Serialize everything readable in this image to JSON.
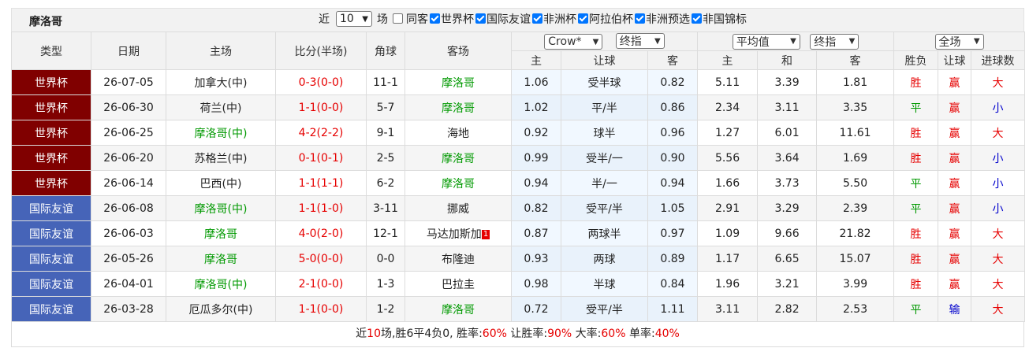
{
  "team": "摩洛哥",
  "filters": {
    "recent_prefix": "近",
    "recent_value": "10",
    "recent_suffix": "场",
    "same_home": "同客",
    "comps": [
      "世界杯",
      "国际友谊",
      "非洲杯",
      "阿拉伯杯",
      "非洲预选",
      "非国锦标"
    ]
  },
  "header": {
    "type": "类型",
    "date": "日期",
    "home": "主场",
    "score": "比分(半场)",
    "corner": "角球",
    "away": "客场",
    "company": "Crow*",
    "odds_kind1": "终指",
    "avg": "平均值",
    "odds_kind2": "终指",
    "range": "全场",
    "sub": {
      "h1": "主",
      "handicap": "让球",
      "a1": "客",
      "h2": "主",
      "draw": "和",
      "a2": "客",
      "wdl": "胜负",
      "hcp": "让球",
      "goals": "进球数"
    }
  },
  "rows": [
    {
      "type": "世界杯",
      "date": "26-07-05",
      "home": "加拿大(中)",
      "score": "0-3",
      "half": "(0-0)",
      "corner": "11-1",
      "away": "摩洛哥",
      "badge": "",
      "o1": "1.06",
      "hcp": "受半球",
      "o2": "0.82",
      "e1": "5.11",
      "e2": "3.39",
      "e3": "1.81",
      "wdl": "胜",
      "hr": "赢",
      "goals": "大"
    },
    {
      "type": "世界杯",
      "date": "26-06-30",
      "home": "荷兰(中)",
      "score": "1-1",
      "half": "(0-0)",
      "corner": "5-7",
      "away": "摩洛哥",
      "badge": "",
      "o1": "1.02",
      "hcp": "平/半",
      "o2": "0.86",
      "e1": "2.34",
      "e2": "3.11",
      "e3": "3.35",
      "wdl": "平",
      "hr": "赢",
      "goals": "小"
    },
    {
      "type": "世界杯",
      "date": "26-06-25",
      "home": "摩洛哥(中)",
      "score": "4-2",
      "half": "(2-2)",
      "corner": "9-1",
      "away": "海地",
      "badge": "",
      "o1": "0.92",
      "hcp": "球半",
      "o2": "0.96",
      "e1": "1.27",
      "e2": "6.01",
      "e3": "11.61",
      "wdl": "胜",
      "hr": "赢",
      "goals": "大"
    },
    {
      "type": "世界杯",
      "date": "26-06-20",
      "home": "苏格兰(中)",
      "score": "0-1",
      "half": "(0-1)",
      "corner": "2-5",
      "away": "摩洛哥",
      "badge": "",
      "o1": "0.99",
      "hcp": "受半/一",
      "o2": "0.90",
      "e1": "5.56",
      "e2": "3.64",
      "e3": "1.69",
      "wdl": "胜",
      "hr": "赢",
      "goals": "小"
    },
    {
      "type": "世界杯",
      "date": "26-06-14",
      "home": "巴西(中)",
      "score": "1-1",
      "half": "(1-1)",
      "corner": "6-2",
      "away": "摩洛哥",
      "badge": "",
      "o1": "0.94",
      "hcp": "半/一",
      "o2": "0.94",
      "e1": "1.66",
      "e2": "3.73",
      "e3": "5.50",
      "wdl": "平",
      "hr": "赢",
      "goals": "小"
    },
    {
      "type": "国际友谊",
      "date": "26-06-08",
      "home": "摩洛哥(中)",
      "score": "1-1",
      "half": "(1-0)",
      "corner": "3-11",
      "away": "挪威",
      "badge": "",
      "o1": "0.82",
      "hcp": "受平/半",
      "o2": "1.05",
      "e1": "2.91",
      "e2": "3.29",
      "e3": "2.39",
      "wdl": "平",
      "hr": "赢",
      "goals": "小"
    },
    {
      "type": "国际友谊",
      "date": "26-06-03",
      "home": "摩洛哥",
      "score": "4-0",
      "half": "(2-0)",
      "corner": "12-1",
      "away": "马达加斯加",
      "badge": "1",
      "o1": "0.87",
      "hcp": "两球半",
      "o2": "0.97",
      "e1": "1.09",
      "e2": "9.66",
      "e3": "21.82",
      "wdl": "胜",
      "hr": "赢",
      "goals": "大"
    },
    {
      "type": "国际友谊",
      "date": "26-05-26",
      "home": "摩洛哥",
      "score": "5-0",
      "half": "(0-0)",
      "corner": "0-0",
      "away": "布隆迪",
      "badge": "",
      "o1": "0.93",
      "hcp": "两球",
      "o2": "0.89",
      "e1": "1.17",
      "e2": "6.65",
      "e3": "15.07",
      "wdl": "胜",
      "hr": "赢",
      "goals": "大"
    },
    {
      "type": "国际友谊",
      "date": "26-04-01",
      "home": "摩洛哥(中)",
      "score": "2-1",
      "half": "(0-0)",
      "corner": "1-3",
      "away": "巴拉圭",
      "badge": "",
      "o1": "0.98",
      "hcp": "半球",
      "o2": "0.84",
      "e1": "1.96",
      "e2": "3.21",
      "e3": "3.99",
      "wdl": "胜",
      "hr": "赢",
      "goals": "大"
    },
    {
      "type": "国际友谊",
      "date": "26-03-28",
      "home": "厄瓜多尔(中)",
      "score": "1-1",
      "half": "(0-0)",
      "corner": "1-2",
      "away": "摩洛哥",
      "badge": "",
      "o1": "0.72",
      "hcp": "受平/半",
      "o2": "1.11",
      "e1": "3.11",
      "e2": "2.82",
      "e3": "2.53",
      "wdl": "平",
      "hr": "输",
      "goals": "大"
    }
  ],
  "summary": {
    "t1": "近",
    "n_matches": "10",
    "t2": "场,胜6平4负0, 胜率:",
    "win_rate": "60%",
    "t3": " 让胜率:",
    "hcp_rate": "90%",
    "t4": " 大率:",
    "over_rate": "60%",
    "t5": " 单率:",
    "odd_rate": "40%"
  },
  "colors": {
    "worldcup": "#800000",
    "friendly": "#4664b8",
    "focus_team": "#009900",
    "win": "#e60000",
    "draw": "#009900",
    "small": "#0000cc"
  }
}
